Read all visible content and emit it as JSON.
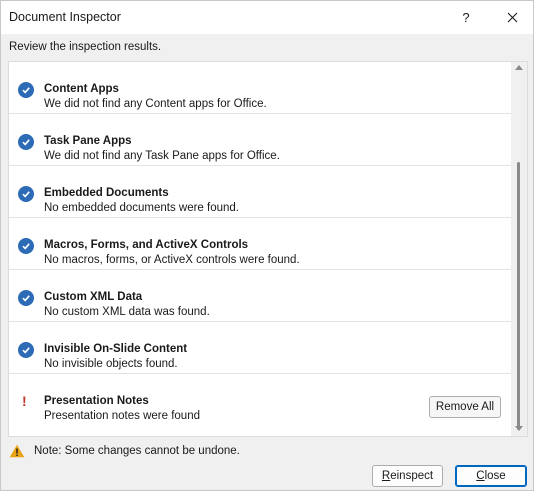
{
  "window": {
    "title": "Document Inspector",
    "help_label": "?",
    "close_label": "✕"
  },
  "subtitle": "Review the inspection results.",
  "results": [
    {
      "title": "Content Apps",
      "description": "We did not find any Content apps for Office.",
      "status": "ok",
      "icon": "check-circle-icon"
    },
    {
      "title": "Task Pane Apps",
      "description": "We did not find any Task Pane apps for Office.",
      "status": "ok",
      "icon": "check-circle-icon"
    },
    {
      "title": "Embedded Documents",
      "description": "No embedded documents were found.",
      "status": "ok",
      "icon": "check-circle-icon"
    },
    {
      "title": "Macros, Forms, and ActiveX Controls",
      "description": "No macros, forms, or ActiveX controls were found.",
      "status": "ok",
      "icon": "check-circle-icon"
    },
    {
      "title": "Custom XML Data",
      "description": "No custom XML data was found.",
      "status": "ok",
      "icon": "check-circle-icon"
    },
    {
      "title": "Invisible On-Slide Content",
      "description": "No invisible objects found.",
      "status": "ok",
      "icon": "check-circle-icon"
    },
    {
      "title": "Presentation Notes",
      "description": "Presentation notes were found",
      "status": "found",
      "icon": "exclamation-icon"
    }
  ],
  "remove_all_label": "Remove All",
  "note": "Note: Some changes cannot be undone.",
  "buttons": {
    "reinspect_first": "R",
    "reinspect_rest": "einspect",
    "close_first": "C",
    "close_rest": "lose"
  },
  "colors": {
    "check": "#2e6bb7",
    "exclamation": "#c0392b",
    "warning": "#e8a317",
    "default_button_border": "#0067c0"
  }
}
